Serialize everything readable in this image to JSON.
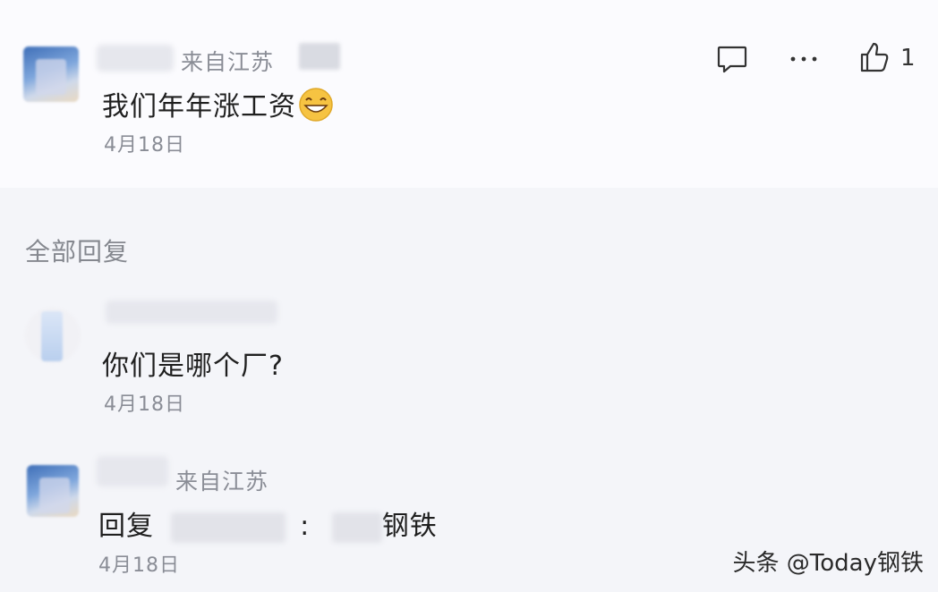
{
  "main_comment": {
    "region": "来自江苏",
    "text": "我们年年涨工资",
    "date": "4月18日",
    "like_count": "1",
    "emoji": "grinning-face-emoji"
  },
  "replies_header": "全部回复",
  "replies": [
    {
      "text": "你们是哪个厂?",
      "date": "4月18日"
    },
    {
      "region": "来自江苏",
      "reply_prefix": "回复",
      "colon": ":",
      "text_suffix": "钢铁",
      "date": "4月18日"
    }
  ],
  "watermark": "头条 @Today钢铁",
  "icons": {
    "comment": "comment-bubble-icon",
    "more": "more-dots-icon",
    "like": "thumbs-up-icon"
  }
}
